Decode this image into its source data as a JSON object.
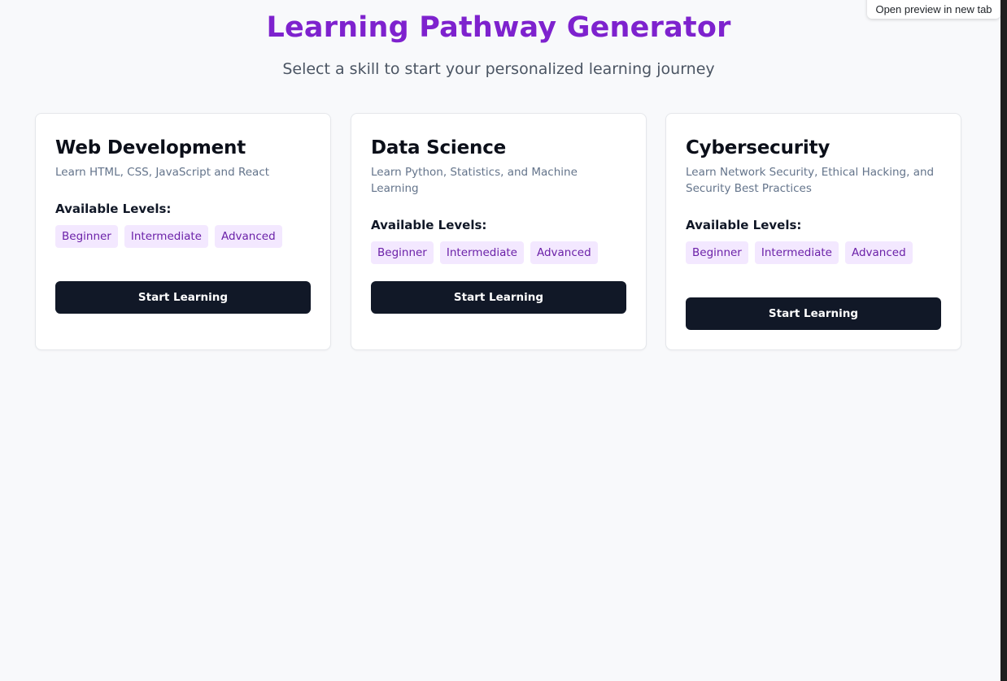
{
  "preview_button": {
    "label": "Open preview in new tab"
  },
  "header": {
    "title": "Learning Pathway Generator",
    "subtitle": "Select a skill to start your personalized learning journey"
  },
  "cards": [
    {
      "title": "Web Development",
      "description": "Learn HTML, CSS, JavaScript and React",
      "levels_label": "Available Levels:",
      "levels": [
        "Beginner",
        "Intermediate",
        "Advanced"
      ],
      "button_label": "Start Learning"
    },
    {
      "title": "Data Science",
      "description": "Learn Python, Statistics, and Machine Learning",
      "levels_label": "Available Levels:",
      "levels": [
        "Beginner",
        "Intermediate",
        "Advanced"
      ],
      "button_label": "Start Learning"
    },
    {
      "title": "Cybersecurity",
      "description": "Learn Network Security, Ethical Hacking, and Security Best Practices",
      "levels_label": "Available Levels:",
      "levels": [
        "Beginner",
        "Intermediate",
        "Advanced"
      ],
      "button_label": "Start Learning"
    }
  ],
  "colors": {
    "title": "#7e22ce",
    "badge_bg": "#f3e8ff",
    "badge_text": "#6b21a8",
    "button_bg": "#111827",
    "page_bg": "#f8f9fb"
  }
}
